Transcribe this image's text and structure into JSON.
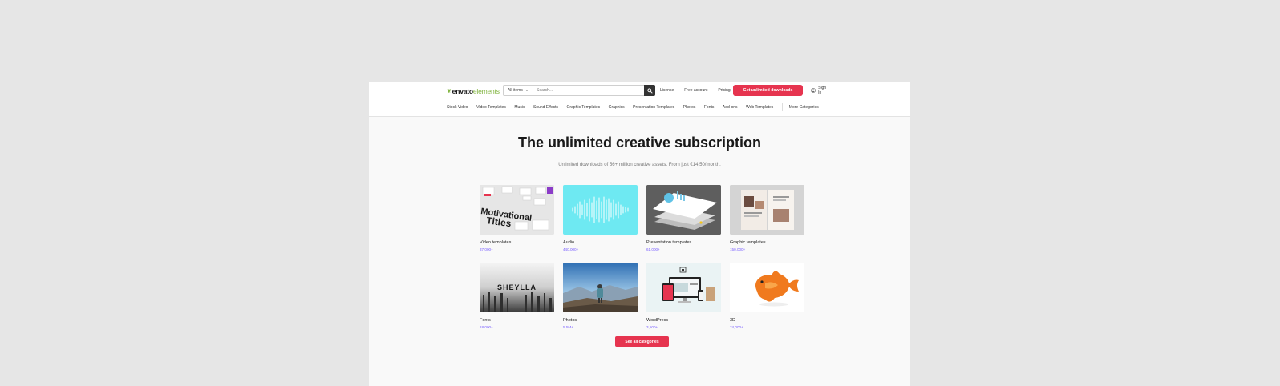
{
  "brand": {
    "logo_bold": "envato",
    "logo_light": "elements"
  },
  "search": {
    "scope": "All items",
    "placeholder": "Search..."
  },
  "nav": {
    "license": "License",
    "free_account": "Free account",
    "pricing": "Pricing"
  },
  "cta": "Get unlimited downloads",
  "signin": "Sign In",
  "categories_nav": [
    "Stock Video",
    "Video Templates",
    "Music",
    "Sound Effects",
    "Graphic Templates",
    "Graphics",
    "Presentation Templates",
    "Photos",
    "Fonts",
    "Add-ons",
    "Web Templates"
  ],
  "more_categories": "More Categories",
  "hero": {
    "title": "The unlimited creative subscription",
    "subtitle": "Unlimited downloads of 56+ million creative assets. From just €14.50/month."
  },
  "cards": [
    {
      "name": "Video templates",
      "count": "37,000+"
    },
    {
      "name": "Audio",
      "count": "440,000+"
    },
    {
      "name": "Presentation templates",
      "count": "61,000+"
    },
    {
      "name": "Graphic templates",
      "count": "150,000+"
    },
    {
      "name": "Fonts",
      "count": "18,000+"
    },
    {
      "name": "Photos",
      "count": "5.5M+"
    },
    {
      "name": "WordPress",
      "count": "3,500+"
    },
    {
      "name": "3D",
      "count": "74,000+"
    }
  ],
  "thumb_text": {
    "video_line1": "Motivational",
    "video_line2": "Titles",
    "font_sample": "SHEYLLA"
  },
  "see_all": "See all categories",
  "colors": {
    "accent": "#e6344f",
    "brand_green": "#82b541",
    "count_purple": "#7b61ff"
  }
}
